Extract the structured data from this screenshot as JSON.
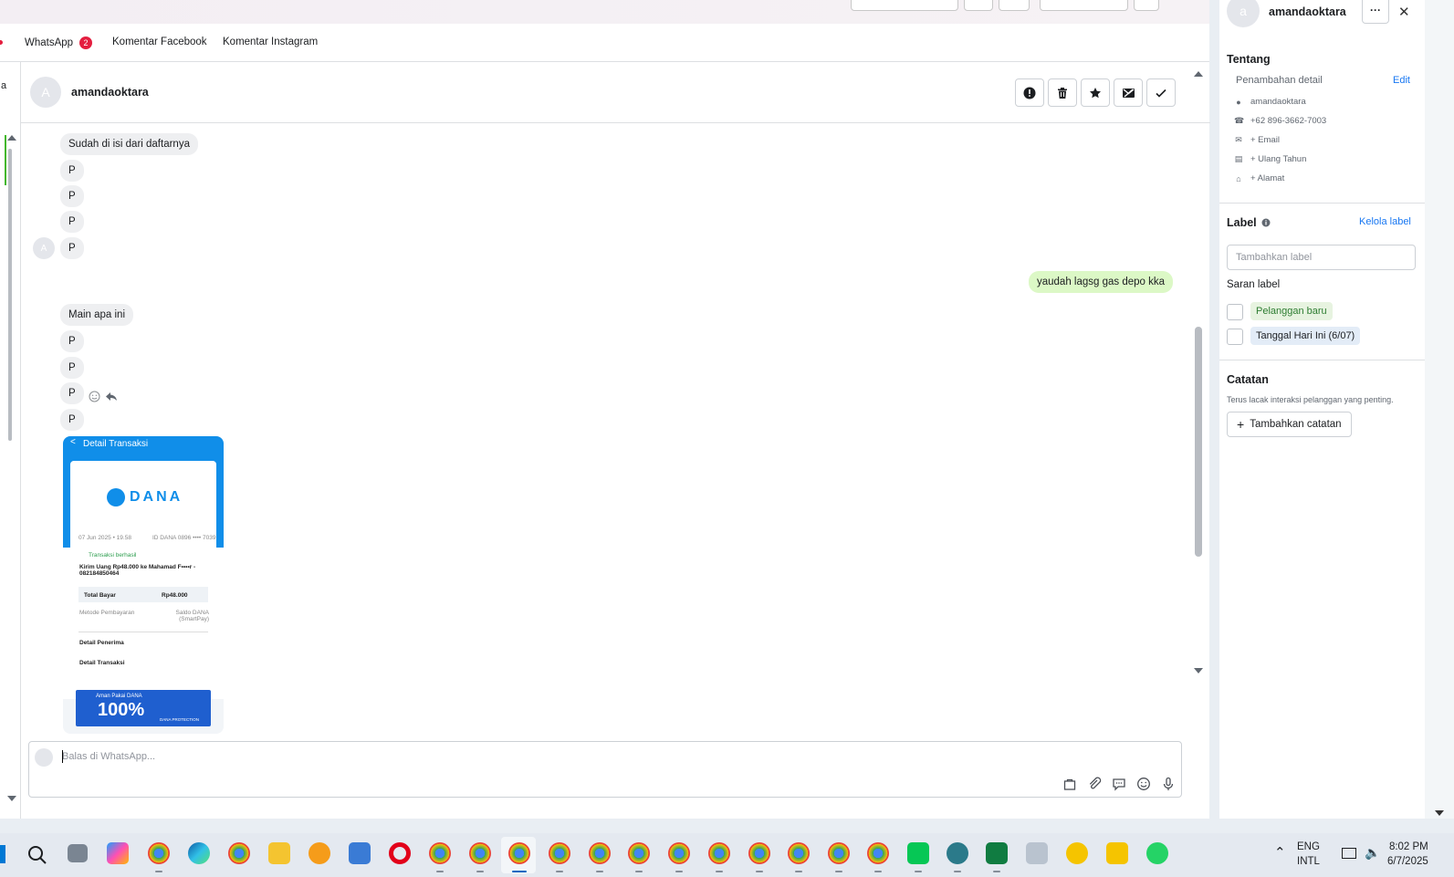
{
  "tabs": [
    {
      "label": "WhatsApp",
      "badge": "2"
    },
    {
      "label": "Komentar Facebook"
    },
    {
      "label": "Komentar Instagram"
    }
  ],
  "left_letter": "a",
  "conversation": {
    "contact_initial": "A",
    "contact_name": "amandaoktara",
    "actions": [
      "report-icon",
      "trash-icon",
      "star-icon",
      "mark-unread-icon",
      "check-icon"
    ],
    "messages": [
      {
        "dir": "in",
        "text": "Sudah di isi dari daftarnya"
      },
      {
        "dir": "in",
        "text": "P"
      },
      {
        "dir": "in",
        "text": "P"
      },
      {
        "dir": "in",
        "text": "P"
      },
      {
        "dir": "in",
        "text": "P"
      },
      {
        "dir": "out",
        "text": "yaudah lagsg gas depo kka"
      },
      {
        "dir": "in",
        "text": "Main apa ini"
      },
      {
        "dir": "in",
        "text": "P"
      },
      {
        "dir": "in",
        "text": "P"
      },
      {
        "dir": "in",
        "text": "P"
      },
      {
        "dir": "in",
        "text": "P"
      }
    ],
    "avatar_initial_small": "A",
    "receipt": {
      "header": "Detail Transaksi",
      "brand": "DANA",
      "date": "07 Jun 2025 • 19.58",
      "id": "ID DANA 0896 •••• 7039",
      "status": "Transaksi berhasil",
      "description": "Kirim Uang Rp48.000 ke Mahamad F••••r - 082184850464",
      "total_label": "Total Bayar",
      "total_value": "Rp48.000",
      "method_label": "Metode Pembayaran",
      "method_value": "Saldo DANA (SmartPay)",
      "recipient_label": "Detail Penerima",
      "detail_label": "Detail Transaksi",
      "banner_text": "Aman Pakai DANA",
      "banner_big": "100%",
      "banner_badge": "DANA PROTECTION"
    },
    "composer_placeholder": "Balas di WhatsApp..."
  },
  "profile": {
    "initial": "a",
    "name": "amandaoktara",
    "more_label": "···",
    "close_label": "✕",
    "about_title": "Tentang",
    "detail_label": "Penambahan detail",
    "edit_label": "Edit",
    "rows": [
      {
        "icon": "person-icon",
        "text": "amandaoktara"
      },
      {
        "icon": "phone-icon",
        "text": "+62 896-3662-7003"
      },
      {
        "icon": "mail-icon",
        "text": "+ Email"
      },
      {
        "icon": "cake-icon",
        "text": "+ Ulang Tahun"
      },
      {
        "icon": "home-icon",
        "text": "+ Alamat"
      }
    ],
    "label_title": "Label",
    "manage_label": "Kelola label",
    "label_placeholder": "Tambahkan label",
    "suggestion_title": "Saran label",
    "suggestions": [
      {
        "text": "Pelanggan baru",
        "color": "#e7f3e0"
      },
      {
        "text": "Tanggal Hari Ini (6/07)",
        "color": "#e3ecf7"
      }
    ],
    "notes_title": "Catatan",
    "notes_desc": "Terus lacak interaksi pelanggan yang penting.",
    "add_note_label": "Tambahkan catatan"
  },
  "taskbar": {
    "lang_top": "ENG",
    "lang_bottom": "INTL",
    "time": "8:02 PM",
    "date": "6/7/2025"
  },
  "colors": {
    "accent": "#1877f2",
    "outgoing": "#dcf8c6",
    "incoming": "#eeeff1",
    "badge": "#e41e3f",
    "dana": "#108ee9"
  }
}
